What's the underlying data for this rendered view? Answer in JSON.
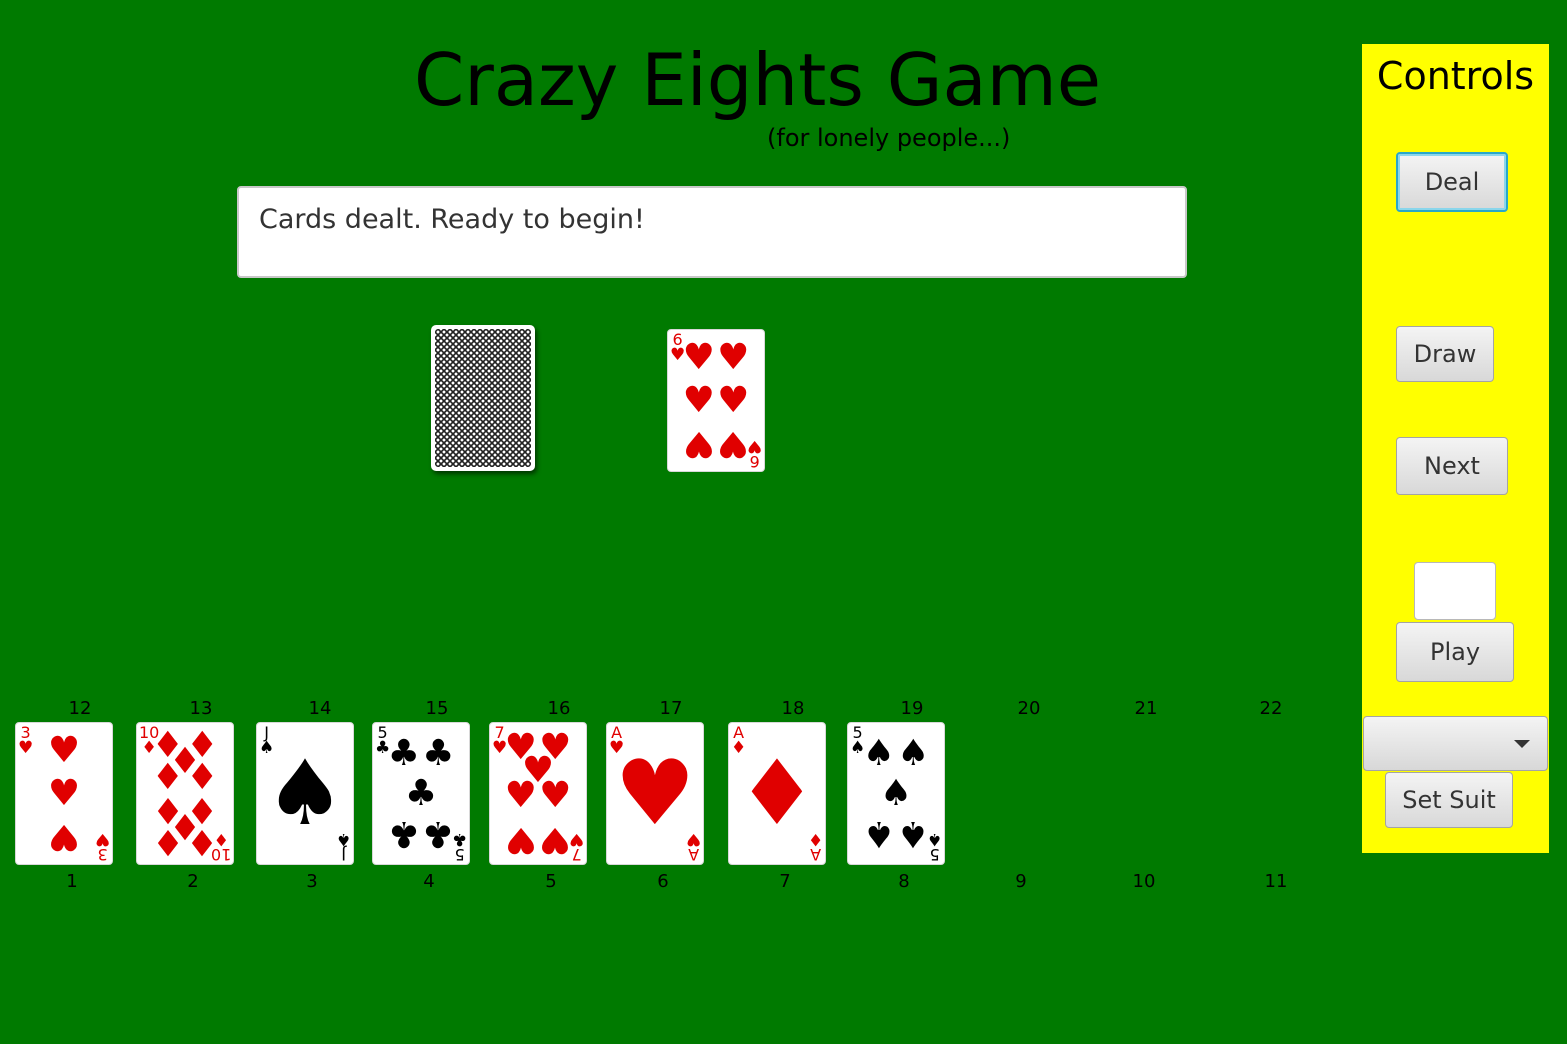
{
  "header": {
    "title": "Crazy Eights Game",
    "subtitle": "(for lonely people...)"
  },
  "message": "Cards dealt. Ready to begin!",
  "table": {
    "deck": "card-back",
    "discard": {
      "rank": "6",
      "suit": "hearts",
      "suit_symbol": "♥",
      "color": "red"
    }
  },
  "hand": {
    "cards": [
      {
        "slot": "1",
        "rank": "3",
        "suit": "hearts",
        "suit_symbol": "♥",
        "color": "red"
      },
      {
        "slot": "2",
        "rank": "10",
        "suit": "diamonds",
        "suit_symbol": "♦",
        "color": "red"
      },
      {
        "slot": "3",
        "rank": "J",
        "suit": "spades",
        "suit_symbol": "♠",
        "color": "black"
      },
      {
        "slot": "4",
        "rank": "5",
        "suit": "clubs",
        "suit_symbol": "♣",
        "color": "black"
      },
      {
        "slot": "5",
        "rank": "7",
        "suit": "hearts",
        "suit_symbol": "♥",
        "color": "red"
      },
      {
        "slot": "6",
        "rank": "A",
        "suit": "hearts",
        "suit_symbol": "♥",
        "color": "red"
      },
      {
        "slot": "7",
        "rank": "A",
        "suit": "diamonds",
        "suit_symbol": "♦",
        "color": "red"
      },
      {
        "slot": "8",
        "rank": "5",
        "suit": "spades",
        "suit_symbol": "♠",
        "color": "black"
      }
    ],
    "bottom_labels": [
      "1",
      "2",
      "3",
      "4",
      "5",
      "6",
      "7",
      "8",
      "9",
      "10",
      "11"
    ],
    "top_labels": [
      "12",
      "13",
      "14",
      "15",
      "16",
      "17",
      "18",
      "19",
      "20",
      "21",
      "22"
    ]
  },
  "controls": {
    "title": "Controls",
    "deal_label": "Deal",
    "draw_label": "Draw",
    "next_label": "Next",
    "card_input_value": "",
    "play_label": "Play",
    "suit_select_value": "",
    "set_suit_label": "Set Suit"
  },
  "colors": {
    "table_green": "#007a00",
    "panel_yellow": "#ffff00",
    "red_suit": "#e00000",
    "black_suit": "#000000",
    "focus_ring": "#2aa7c8"
  }
}
